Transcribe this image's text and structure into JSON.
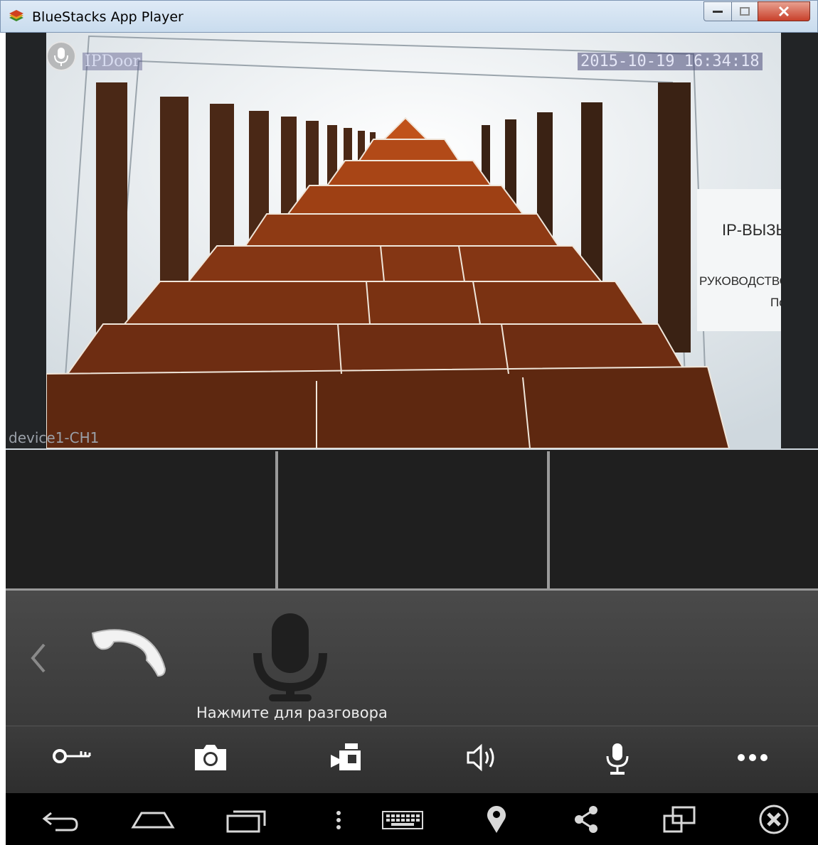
{
  "window": {
    "title": "BlueStacks App Player"
  },
  "video": {
    "brand": "IPDoor",
    "timestamp": "2015-10-19 16:34:18",
    "device_label": "device1-CH1"
  },
  "call_panel": {
    "talk_label": "Нажмите для разговора"
  },
  "action_bar": {
    "items": [
      "unlock-key",
      "snapshot-camera",
      "record-video",
      "speaker",
      "microphone",
      "more"
    ]
  },
  "nav_bar": {
    "items": [
      "back",
      "home",
      "recent-apps",
      "menu",
      "keyboard",
      "location",
      "share",
      "multi-window",
      "close-app"
    ]
  },
  "colors": {
    "titlebar": "#c9dcee",
    "app_background": "#202020",
    "call_panel": "#444444",
    "nav_bar": "#000000",
    "icon": "#ffffff"
  }
}
